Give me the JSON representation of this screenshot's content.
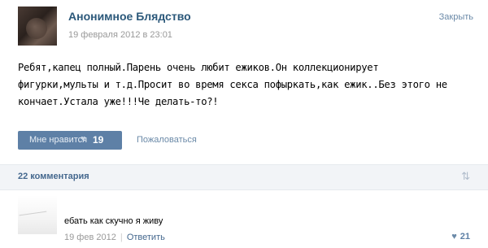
{
  "post": {
    "group_name": "Анонимное Блядство",
    "date": "19 февраля 2012 в 23:01",
    "collapse_label": "Закрыть",
    "text_lines": [
      "Ребят,капец полный.Парень очень любит ежиков.Он коллекционирует",
      "фигурки,мульты и т.д.Просит во время секса пофыркать,как ежик..Без этого не",
      "кончает.Устала уже!!!Че делать-то?!"
    ],
    "like_label": "Мне нравится",
    "like_count": "19",
    "share_label": "Пожаловаться"
  },
  "comments": {
    "count_label": "22 комментария",
    "items": [
      {
        "text": "ебать как скучно я живу",
        "date": "19 фев 2012",
        "separator": "|",
        "reply_label": "Ответить",
        "likes": "21"
      }
    ]
  },
  "icons": {
    "heart": "heart-icon",
    "sort": "sort-arrows-icon"
  },
  "colors": {
    "link": "#2b587a",
    "button": "#5e80a6",
    "comments_bar": "#f2f4f7"
  }
}
